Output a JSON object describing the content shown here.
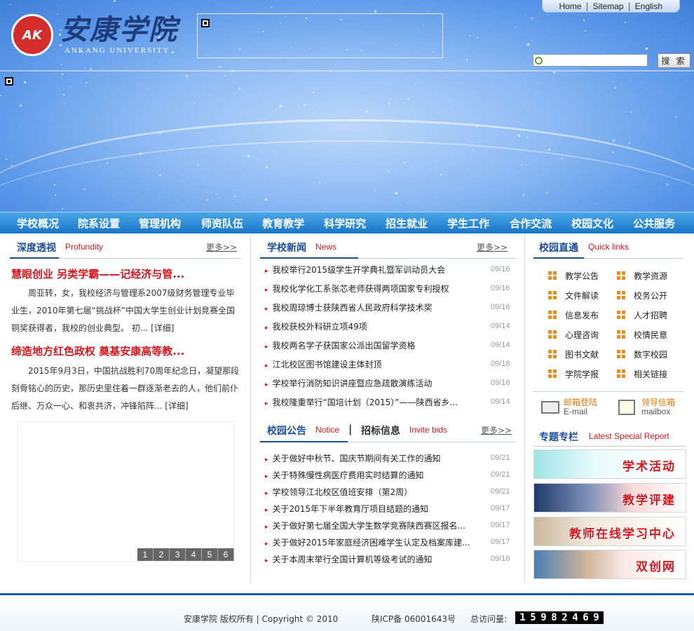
{
  "header": {
    "top_links": [
      "Home",
      "Sitemap",
      "English"
    ],
    "logo_cn": "安康学院",
    "logo_en": "ANKANG   UNIVERSITY",
    "logo_mark": "AK",
    "search_button": "搜 索",
    "search_placeholder": ""
  },
  "nav": [
    "学校概况",
    "院系设置",
    "管理机构",
    "师资队伍",
    "教育教学",
    "科学研究",
    "招生就业",
    "学生工作",
    "合作交流",
    "校园文化",
    "公共服务"
  ],
  "profundity": {
    "title": "深度透视",
    "title_en": "Profundity",
    "more": "更多>>",
    "articles": [
      {
        "headline": "慧眼创业  另类学霸——记经济与管...",
        "body": "周亚转，女，我校经济与管理系2007级财务管理专业毕业生，2010年第七届“挑战杯”中国大学生创业计划竞赛全国铜奖获得者，我校的创业典型。 初...  [详细]"
      },
      {
        "headline": "缔造地方红色政权  奠基安康高等教...",
        "body": "2015年9月3日，中国抗战胜利70周年纪念日，凝望那段刻骨铭心的历史，那历史里住着一群逐渐老去的人，他们前仆后继、万众一心、和衷共济，冲锋陷阵...  [详细]"
      }
    ],
    "pager": [
      "1",
      "2",
      "3",
      "4",
      "5",
      "6"
    ]
  },
  "school_news": {
    "title": "学校新闻",
    "title_en": "News",
    "more": "更多>>",
    "items": [
      {
        "title": "我校举行2015级学生开学典礼暨军训动员大会",
        "date": "09/16"
      },
      {
        "title": "我校化学化工系张芯老师获得两项国家专利授权",
        "date": "09/16"
      },
      {
        "title": "我校周琼博士获陕西省人民政府科学技术奖",
        "date": "09/16"
      },
      {
        "title": "我校获校外科研立项49项",
        "date": "09/14"
      },
      {
        "title": "我校两名学子获国家公派出国留学资格",
        "date": "09/14"
      },
      {
        "title": "江北校区图书馆建设主体封顶",
        "date": "09/18"
      },
      {
        "title": "学校举行消防知识讲座暨应急疏散演练活动",
        "date": "09/16"
      },
      {
        "title": "我校隆重举行“国培计划（2015）”——陕西省乡...",
        "date": "09/14"
      }
    ]
  },
  "notices": {
    "title": "校园公告",
    "title_en": "Notice",
    "separator": "|",
    "title2": "招标信息",
    "title2_en": "Invite bids",
    "more": "更多>>",
    "items": [
      {
        "title": "关于做好中秋节、国庆节期间有关工作的通知",
        "date": "09/21"
      },
      {
        "title": "关于特殊慢性病医疗费用实时结算的通知",
        "date": "09/21"
      },
      {
        "title": "学校领导江北校区值班安排（第2周）",
        "date": "09/21"
      },
      {
        "title": "关于2015年下半年教育厅项目结题的通知",
        "date": "09/17"
      },
      {
        "title": "关于做好第七届全国大学生数学竞赛陕西赛区报名...",
        "date": "09/17"
      },
      {
        "title": "关于做好2015年家庭经济困难学生认定及档案库建...",
        "date": "09/17"
      },
      {
        "title": "关于本周末举行全国计算机等级考试的通知",
        "date": "09/16"
      }
    ]
  },
  "quick_links": {
    "title": "校园直通",
    "title_en": "Quick links",
    "items": [
      "教学公告",
      "教学资源",
      "文件解读",
      "校务公开",
      "信息发布",
      "人才招聘",
      "心理咨询",
      "校情民意",
      "图书文献",
      "数字校园",
      "学院学报",
      "相关链接"
    ],
    "mail": {
      "label": "邮箱登陆",
      "sub": "E-mail"
    },
    "leader_mail": {
      "label": "领导信箱",
      "sub": "mailbox"
    }
  },
  "special": {
    "title": "专题专栏",
    "title_en": "Latest Special Report",
    "banners": [
      "学术活动",
      "教学评建",
      "教师在线学习中心",
      "双创网"
    ]
  },
  "footer": {
    "copyright": "安康学院  版权所有  |  Copyright © 2010",
    "icp": "陕ICP备  06001643号",
    "visits_label": "总访问量:",
    "visits_digits": [
      "1",
      "5",
      "9",
      "8",
      "2",
      "4",
      "6",
      "9"
    ]
  }
}
